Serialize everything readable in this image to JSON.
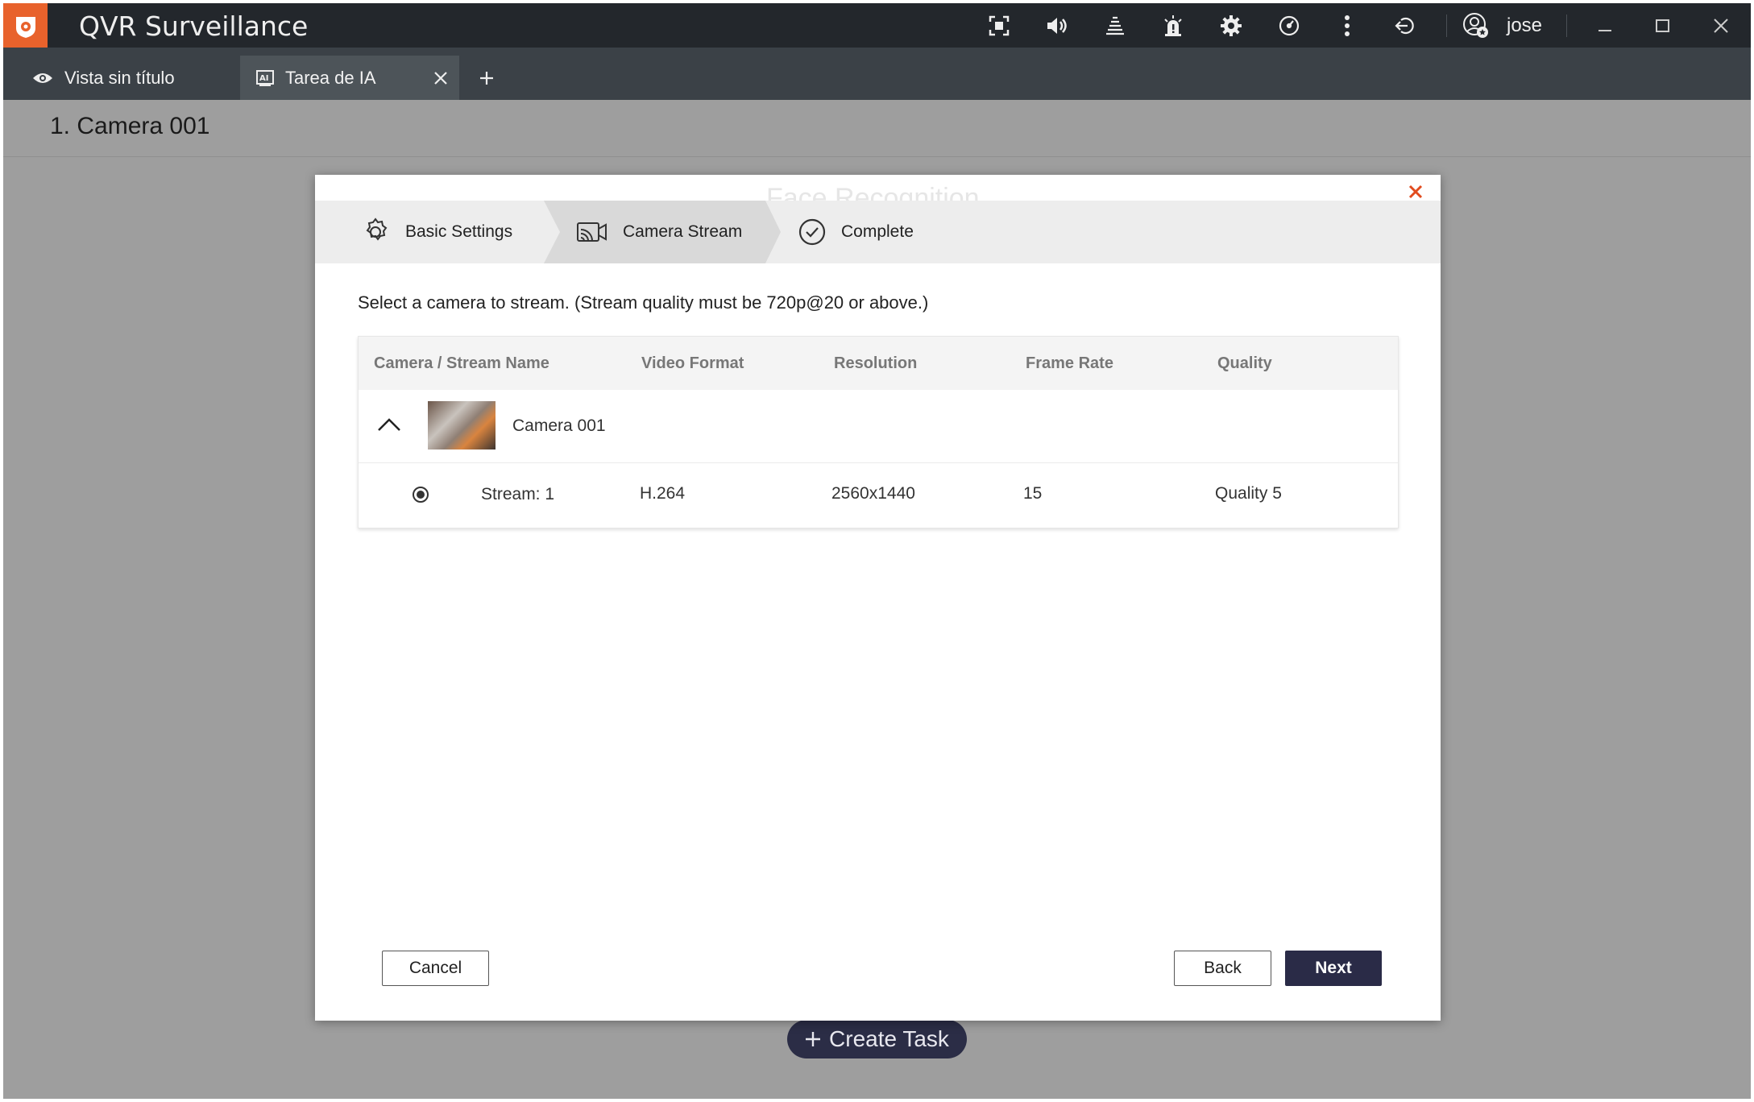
{
  "app": {
    "title": "QVR Surveillance",
    "username": "jose",
    "accent_color": "#e8622c",
    "toolbar_icons": [
      "fullscreen-icon",
      "volume-icon",
      "event-log-icon",
      "alarm-icon",
      "settings-icon",
      "performance-icon",
      "more-icon",
      "logout-icon",
      "user-icon",
      "minimize-icon",
      "maximize-icon",
      "close-icon"
    ]
  },
  "tabs": [
    {
      "label": "Vista sin título",
      "icon": "eye-icon",
      "active": false
    },
    {
      "label": "Tarea de IA",
      "icon": "ai-icon",
      "active": true
    }
  ],
  "page": {
    "title": "1. Camera 001",
    "create_task_label": "Create Task"
  },
  "dialog": {
    "ghost_title": "Face Recognition",
    "steps": [
      {
        "label": "Basic Settings",
        "icon": "gear-icon",
        "active": false
      },
      {
        "label": "Camera Stream",
        "icon": "camera-stream-icon",
        "active": true
      },
      {
        "label": "Complete",
        "icon": "check-circle-icon",
        "active": false
      }
    ],
    "instruction": "Select a camera to stream. (Stream quality must be 720p@20 or above.)",
    "table": {
      "columns": [
        "Camera / Stream Name",
        "Video Format",
        "Resolution",
        "Frame Rate",
        "Quality"
      ],
      "camera": {
        "name": "Camera 001",
        "expanded": true
      },
      "stream": {
        "name": "Stream: 1",
        "video_format": "H.264",
        "resolution": "2560x1440",
        "frame_rate": "15",
        "quality": "Quality 5",
        "selected": true
      }
    },
    "buttons": {
      "cancel": "Cancel",
      "back": "Back",
      "next": "Next"
    },
    "primary_color": "#2a2b47"
  }
}
